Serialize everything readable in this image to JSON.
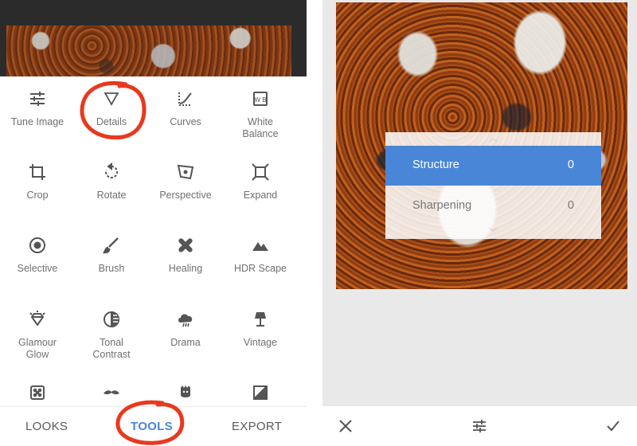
{
  "left_panel": {
    "tools": [
      {
        "label": "Tune Image",
        "icon": "sliders-icon"
      },
      {
        "label": "Details",
        "icon": "triangle-icon"
      },
      {
        "label": "Curves",
        "icon": "curves-icon"
      },
      {
        "label": "White\nBalance",
        "icon": "white-balance-icon"
      },
      {
        "label": "Crop",
        "icon": "crop-icon"
      },
      {
        "label": "Rotate",
        "icon": "rotate-icon"
      },
      {
        "label": "Perspective",
        "icon": "perspective-icon"
      },
      {
        "label": "Expand",
        "icon": "expand-icon"
      },
      {
        "label": "Selective",
        "icon": "selective-icon"
      },
      {
        "label": "Brush",
        "icon": "brush-icon"
      },
      {
        "label": "Healing",
        "icon": "healing-icon"
      },
      {
        "label": "HDR Scape",
        "icon": "mountains-icon"
      },
      {
        "label": "Glamour\nGlow",
        "icon": "diamond-icon"
      },
      {
        "label": "Tonal\nContrast",
        "icon": "tonal-contrast-icon"
      },
      {
        "label": "Drama",
        "icon": "cloud-icon"
      },
      {
        "label": "Vintage",
        "icon": "lamp-icon"
      },
      {
        "label": "",
        "icon": "dice-icon"
      },
      {
        "label": "",
        "icon": "mustache-icon"
      },
      {
        "label": "",
        "icon": "face-icon"
      },
      {
        "label": "",
        "icon": "frame-icon"
      }
    ],
    "nav": {
      "looks": "LOOKS",
      "tools": "TOOLS",
      "export": "EXPORT",
      "active": "TOOLS"
    }
  },
  "right_panel": {
    "adjustments": [
      {
        "name": "Structure",
        "value": "0",
        "selected": true
      },
      {
        "name": "Sharpening",
        "value": "0",
        "selected": false
      }
    ],
    "bottom_icons": [
      "close-icon",
      "sliders-icon",
      "check-icon"
    ]
  },
  "colors": {
    "accent": "#4a86d8",
    "annotation": "#e8391e",
    "text": "#707070"
  }
}
